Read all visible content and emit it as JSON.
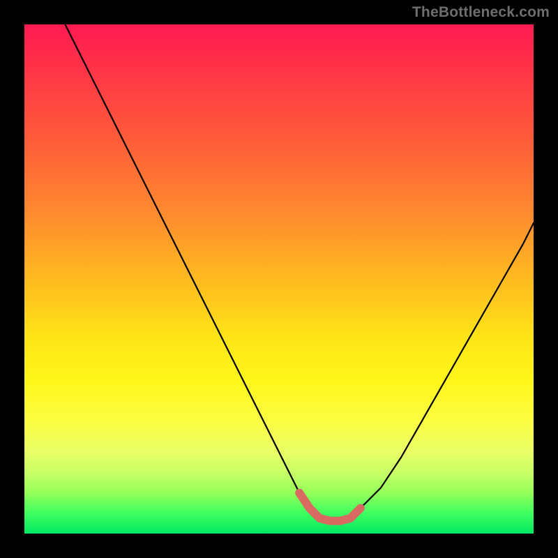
{
  "watermark": "TheBottleneck.com",
  "chart_data": {
    "type": "line",
    "title": "",
    "xlabel": "",
    "ylabel": "",
    "xlim": [
      0,
      100
    ],
    "ylim": [
      0,
      100
    ],
    "grid": false,
    "series": [
      {
        "name": "bottleneck-curve",
        "color": "#000000",
        "x": [
          8,
          12,
          16,
          20,
          24,
          28,
          32,
          36,
          40,
          44,
          48,
          52,
          54,
          56,
          58,
          60,
          62,
          64,
          66,
          70,
          74,
          78,
          82,
          86,
          90,
          94,
          98,
          100
        ],
        "y": [
          100,
          92,
          84,
          76,
          68,
          60,
          52,
          44,
          36,
          28,
          20,
          12,
          8,
          5,
          3,
          2.5,
          2.5,
          3,
          5,
          9,
          15,
          22,
          29,
          36,
          43,
          50,
          57,
          61
        ]
      },
      {
        "name": "optimal-zone",
        "color": "#d96a62",
        "x": [
          54,
          56,
          58,
          60,
          62,
          64,
          66
        ],
        "y": [
          8,
          5,
          3,
          2.5,
          2.5,
          3,
          5
        ]
      }
    ],
    "background_gradient": {
      "top": "#ff1a52",
      "mid": "#ffe617",
      "bottom": "#00e862"
    }
  }
}
